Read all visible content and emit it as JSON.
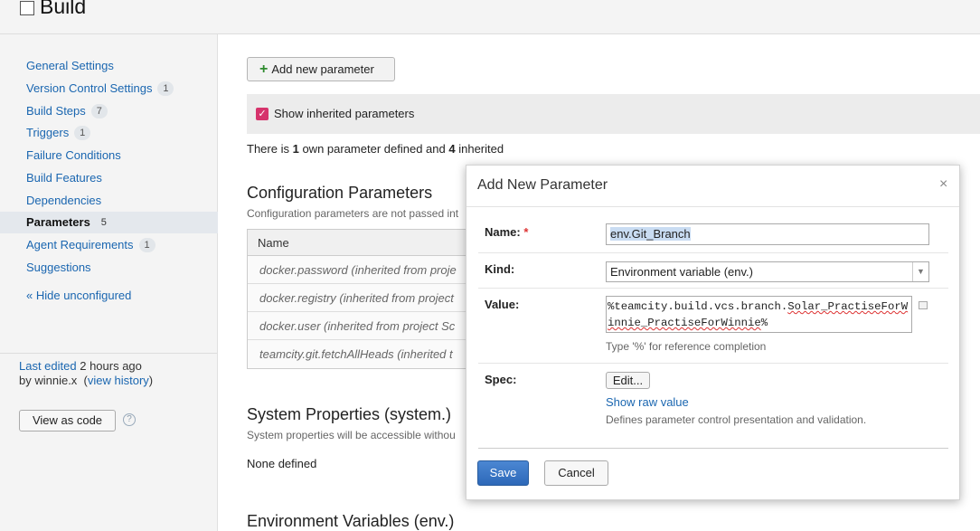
{
  "header": {
    "title": "Build"
  },
  "sidebar": {
    "items": [
      {
        "label": "General Settings",
        "count": ""
      },
      {
        "label": "Version Control Settings",
        "count": "1"
      },
      {
        "label": "Build Steps",
        "count": "7"
      },
      {
        "label": "Triggers",
        "count": "1"
      },
      {
        "label": "Failure Conditions",
        "count": ""
      },
      {
        "label": "Build Features",
        "count": ""
      },
      {
        "label": "Dependencies",
        "count": ""
      },
      {
        "label": "Parameters",
        "count": "5",
        "active": true
      },
      {
        "label": "Agent Requirements",
        "count": "1"
      },
      {
        "label": "Suggestions",
        "count": ""
      }
    ],
    "hide_unconfigured": "« Hide unconfigured",
    "last_edited_label": "Last edited",
    "last_edited_time": "2 hours ago",
    "last_edited_by": "by winnie.x",
    "view_history": "view history",
    "view_as_code": "View as code",
    "help_icon": "?"
  },
  "main": {
    "add_param_button": "Add new parameter",
    "show_inherited": "Show inherited parameters",
    "summary_pre": "There is",
    "summary_own": "1",
    "summary_mid": "own parameter defined and",
    "summary_inherited": "4",
    "summary_post": "inherited",
    "config_title": "Configuration Parameters",
    "config_desc": "Configuration parameters are not passed int",
    "table_header_name": "Name",
    "config_rows": [
      "docker.password (inherited from proje",
      "docker.registry (inherited from project",
      "docker.user (inherited from project Sc",
      "teamcity.git.fetchAllHeads (inherited t"
    ],
    "system_title": "System Properties (system.)",
    "system_desc": "System properties will be accessible withou",
    "none_defined": "None defined",
    "env_title": "Environment Variables (env.)"
  },
  "dialog": {
    "title": "Add New Parameter",
    "close": "×",
    "name_label": "Name:",
    "required_mark": "*",
    "name_value": "env.Git_Branch",
    "kind_label": "Kind:",
    "kind_value": "Environment variable (env.)",
    "value_label": "Value:",
    "value_prefix": "%teamcity.build.vcs.branch.",
    "value_main": "Solar_PractiseForWinnie_PractiseForWinnie",
    "value_suffix": "%",
    "value_hint": "Type '%' for reference completion",
    "spec_label": "Spec:",
    "edit_button": "Edit...",
    "show_raw_value": "Show raw value",
    "spec_hint": "Defines parameter control presentation and validation.",
    "save_button": "Save",
    "cancel_button": "Cancel"
  },
  "colors": {
    "link": "#1a66b0",
    "primary_button": "#3474c4",
    "checkbox": "#d6336c"
  }
}
